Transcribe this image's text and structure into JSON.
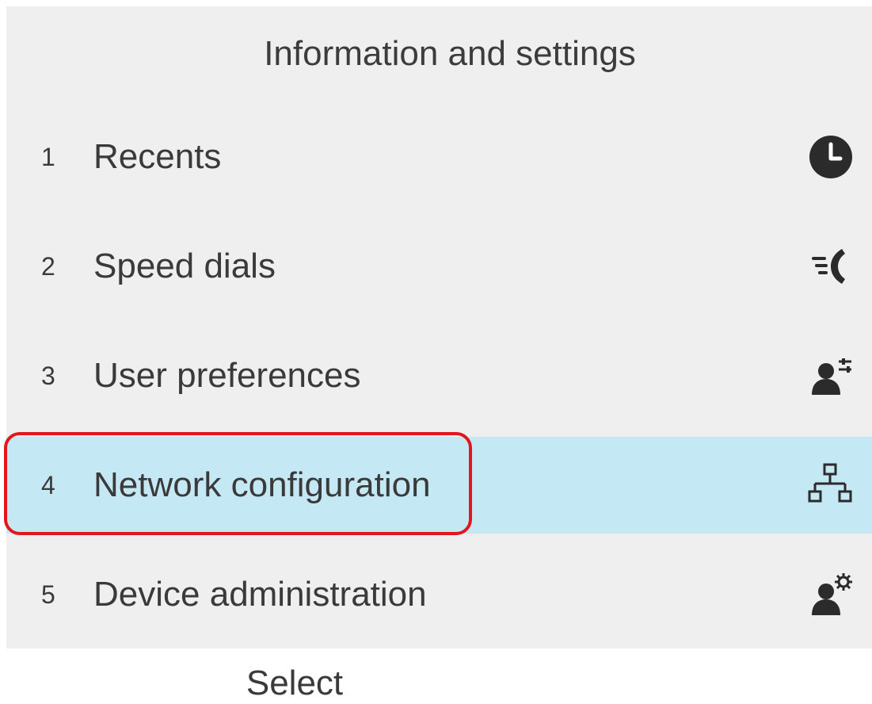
{
  "header": {
    "title": "Information and settings"
  },
  "menu": {
    "items": [
      {
        "number": "1",
        "label": "Recents",
        "icon": "clock-icon"
      },
      {
        "number": "2",
        "label": "Speed dials",
        "icon": "speed-dial-icon"
      },
      {
        "number": "3",
        "label": "User preferences",
        "icon": "user-preferences-icon"
      },
      {
        "number": "4",
        "label": "Network configuration",
        "icon": "network-icon",
        "selected": true
      },
      {
        "number": "5",
        "label": "Device administration",
        "icon": "user-gear-icon"
      }
    ]
  },
  "softkeys": {
    "select_label": "Select"
  },
  "colors": {
    "screen_background": "#efefef",
    "selected_row": "#c5e8f5",
    "highlight_outline": "#e3161b",
    "text": "#3a3a3a",
    "icon": "#2b2b2b"
  }
}
